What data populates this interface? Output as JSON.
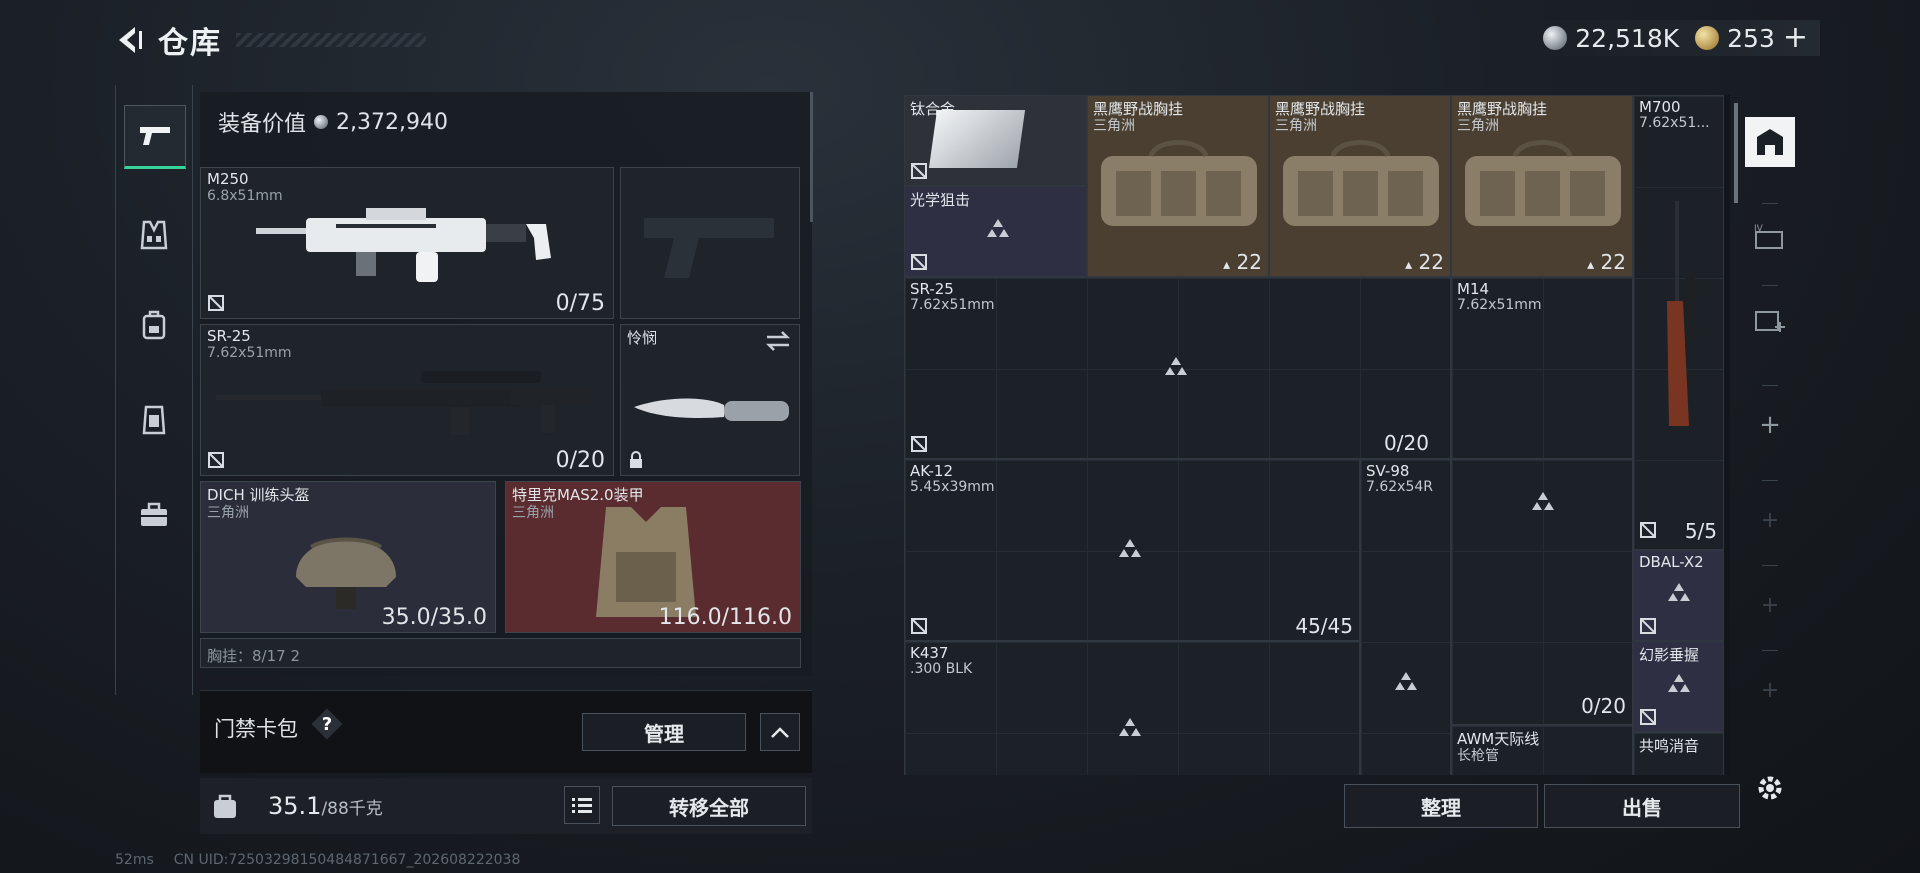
{
  "header": {
    "title": "仓库"
  },
  "currency": {
    "silver": "22,518K",
    "gold": "253"
  },
  "rail": {
    "tabs": [
      {
        "icon": "pistol-icon",
        "active": true
      },
      {
        "icon": "vest-icon"
      },
      {
        "icon": "backpack-icon"
      },
      {
        "icon": "armor-icon"
      },
      {
        "icon": "briefcase-icon"
      }
    ]
  },
  "equipment": {
    "value_label": "装备价值",
    "value": "2,372,940",
    "slots": {
      "primary": {
        "name": "M250",
        "caliber": "6.8x51mm",
        "ammo": "0/75"
      },
      "sidearm": {
        "name": ""
      },
      "secondary": {
        "name": "SR-25",
        "caliber": "7.62x51mm",
        "ammo": "0/20"
      },
      "melee": {
        "name": "怜悯"
      },
      "helmet": {
        "name": "DICH 训练头盔",
        "sub": "三角洲",
        "durability": "35.0/35.0"
      },
      "armor": {
        "name": "特里克MAS2.0装甲",
        "sub": "三角洲",
        "durability": "116.0/116.0"
      },
      "partial": {
        "name": "胸挂：8/17  2"
      }
    }
  },
  "keycard": {
    "label": "门禁卡包",
    "help": "?",
    "manage": "管理"
  },
  "weight": {
    "current": "35.1",
    "max": "/88千克",
    "transfer_all": "转移全部"
  },
  "footer": {
    "ping": "52ms",
    "uid": "CN UID:7250329815048487​1667_202608222038"
  },
  "stash": {
    "items": {
      "titanium": {
        "name": "钛合金"
      },
      "optic": {
        "name": "光学狙击"
      },
      "vest1": {
        "name": "黑鹰野战胸挂",
        "sub": "三角洲",
        "count": "22"
      },
      "vest2": {
        "name": "黑鹰野战胸挂",
        "sub": "三角洲",
        "count": "22"
      },
      "vest3": {
        "name": "黑鹰野战胸挂",
        "sub": "三角洲",
        "count": "22"
      },
      "m700": {
        "name": "M700",
        "sub": "7.62x51...",
        "ammo": "5/5"
      },
      "sr25": {
        "name": "SR-25",
        "sub": "7.62x51mm"
      },
      "m14": {
        "name": "M14",
        "sub": "7.62x51mm",
        "ammo": "0/20"
      },
      "ak12": {
        "name": "AK-12",
        "sub": "5.45x39mm",
        "ammo": "45/45"
      },
      "sv98": {
        "name": "SV-98",
        "sub": "7.62x54R"
      },
      "dbal": {
        "name": "DBAL-X2"
      },
      "k437": {
        "name": "K437",
        "sub": ".300 BLK"
      },
      "grip": {
        "name": "幻影垂握"
      },
      "sv98ammo": {
        "ammo": "0/20"
      },
      "awm": {
        "name": "AWM天际线",
        "sub": "长枪管"
      },
      "suppressor": {
        "name": "共鸣消音"
      }
    },
    "sort_label": "整理",
    "sell_label": "出售"
  }
}
